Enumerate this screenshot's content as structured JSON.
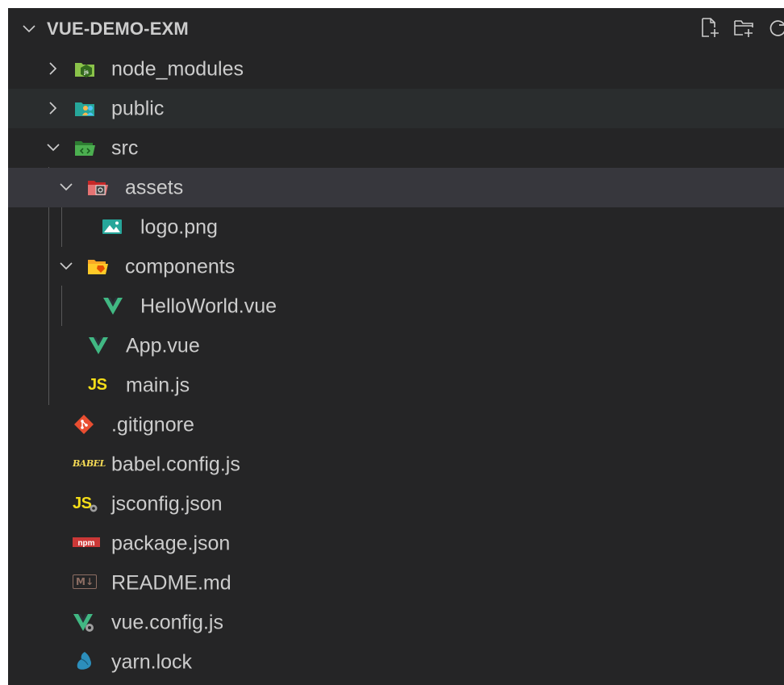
{
  "explorer": {
    "title": "VUE-DEMO-EXM",
    "actions": [
      "new-file-icon",
      "new-folder-icon",
      "refresh-icon"
    ]
  },
  "tree": {
    "node_modules": "node_modules",
    "public": "public",
    "src": "src",
    "assets": "assets",
    "logo": "logo.png",
    "components": "components",
    "helloworld": "HelloWorld.vue",
    "app": "App.vue",
    "main": "main.js",
    "gitignore": ".gitignore",
    "babel": "babel.config.js",
    "jsconfig": "jsconfig.json",
    "package": "package.json",
    "readme": "README.md",
    "vueconfig": "vue.config.js",
    "yarn": "yarn.lock"
  },
  "icon_text": {
    "js": "JS",
    "babel": "BABEL",
    "npm": "npm",
    "markdown": "M↓"
  },
  "colors": {
    "sidebar_bg": "#252526",
    "hover_bg": "#2a2d2e",
    "selected_bg": "#37373d",
    "vue_green": "#41b883",
    "js_yellow": "#f5de19",
    "git_red": "#e94e31",
    "npm_red": "#cb3837"
  }
}
